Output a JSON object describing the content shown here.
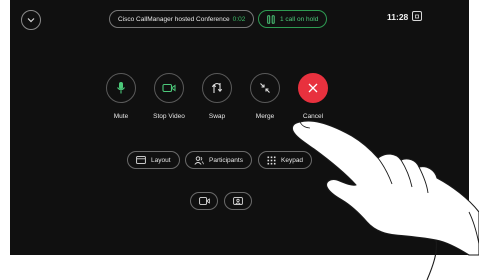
{
  "header": {
    "conference_label": "Cisco CallManager hosted Conference",
    "conference_timer": "0:02",
    "on_hold_label": "1 call on hold",
    "clock": "11:28"
  },
  "actions": [
    {
      "label": "Mute"
    },
    {
      "label": "Stop Video"
    },
    {
      "label": "Swap"
    },
    {
      "label": "Merge"
    },
    {
      "label": "Cancel"
    }
  ],
  "options": {
    "layout_label": "Layout",
    "participants_label": "Participants",
    "keypad_label": "Keypad"
  },
  "colors": {
    "accent_green": "#4cc97a",
    "cancel_red": "#e8313e",
    "background": "#101010"
  },
  "icons": {
    "chevron": "chevron-down-icon",
    "hold": "pause-icon",
    "mute": "microphone-icon",
    "video": "camera-icon",
    "swap": "swap-icon",
    "merge": "merge-icon",
    "cancel": "close-icon",
    "layout": "layout-icon",
    "participants": "people-icon",
    "keypad": "keypad-icon",
    "selfview": "selfview-icon",
    "share": "share-icon"
  }
}
